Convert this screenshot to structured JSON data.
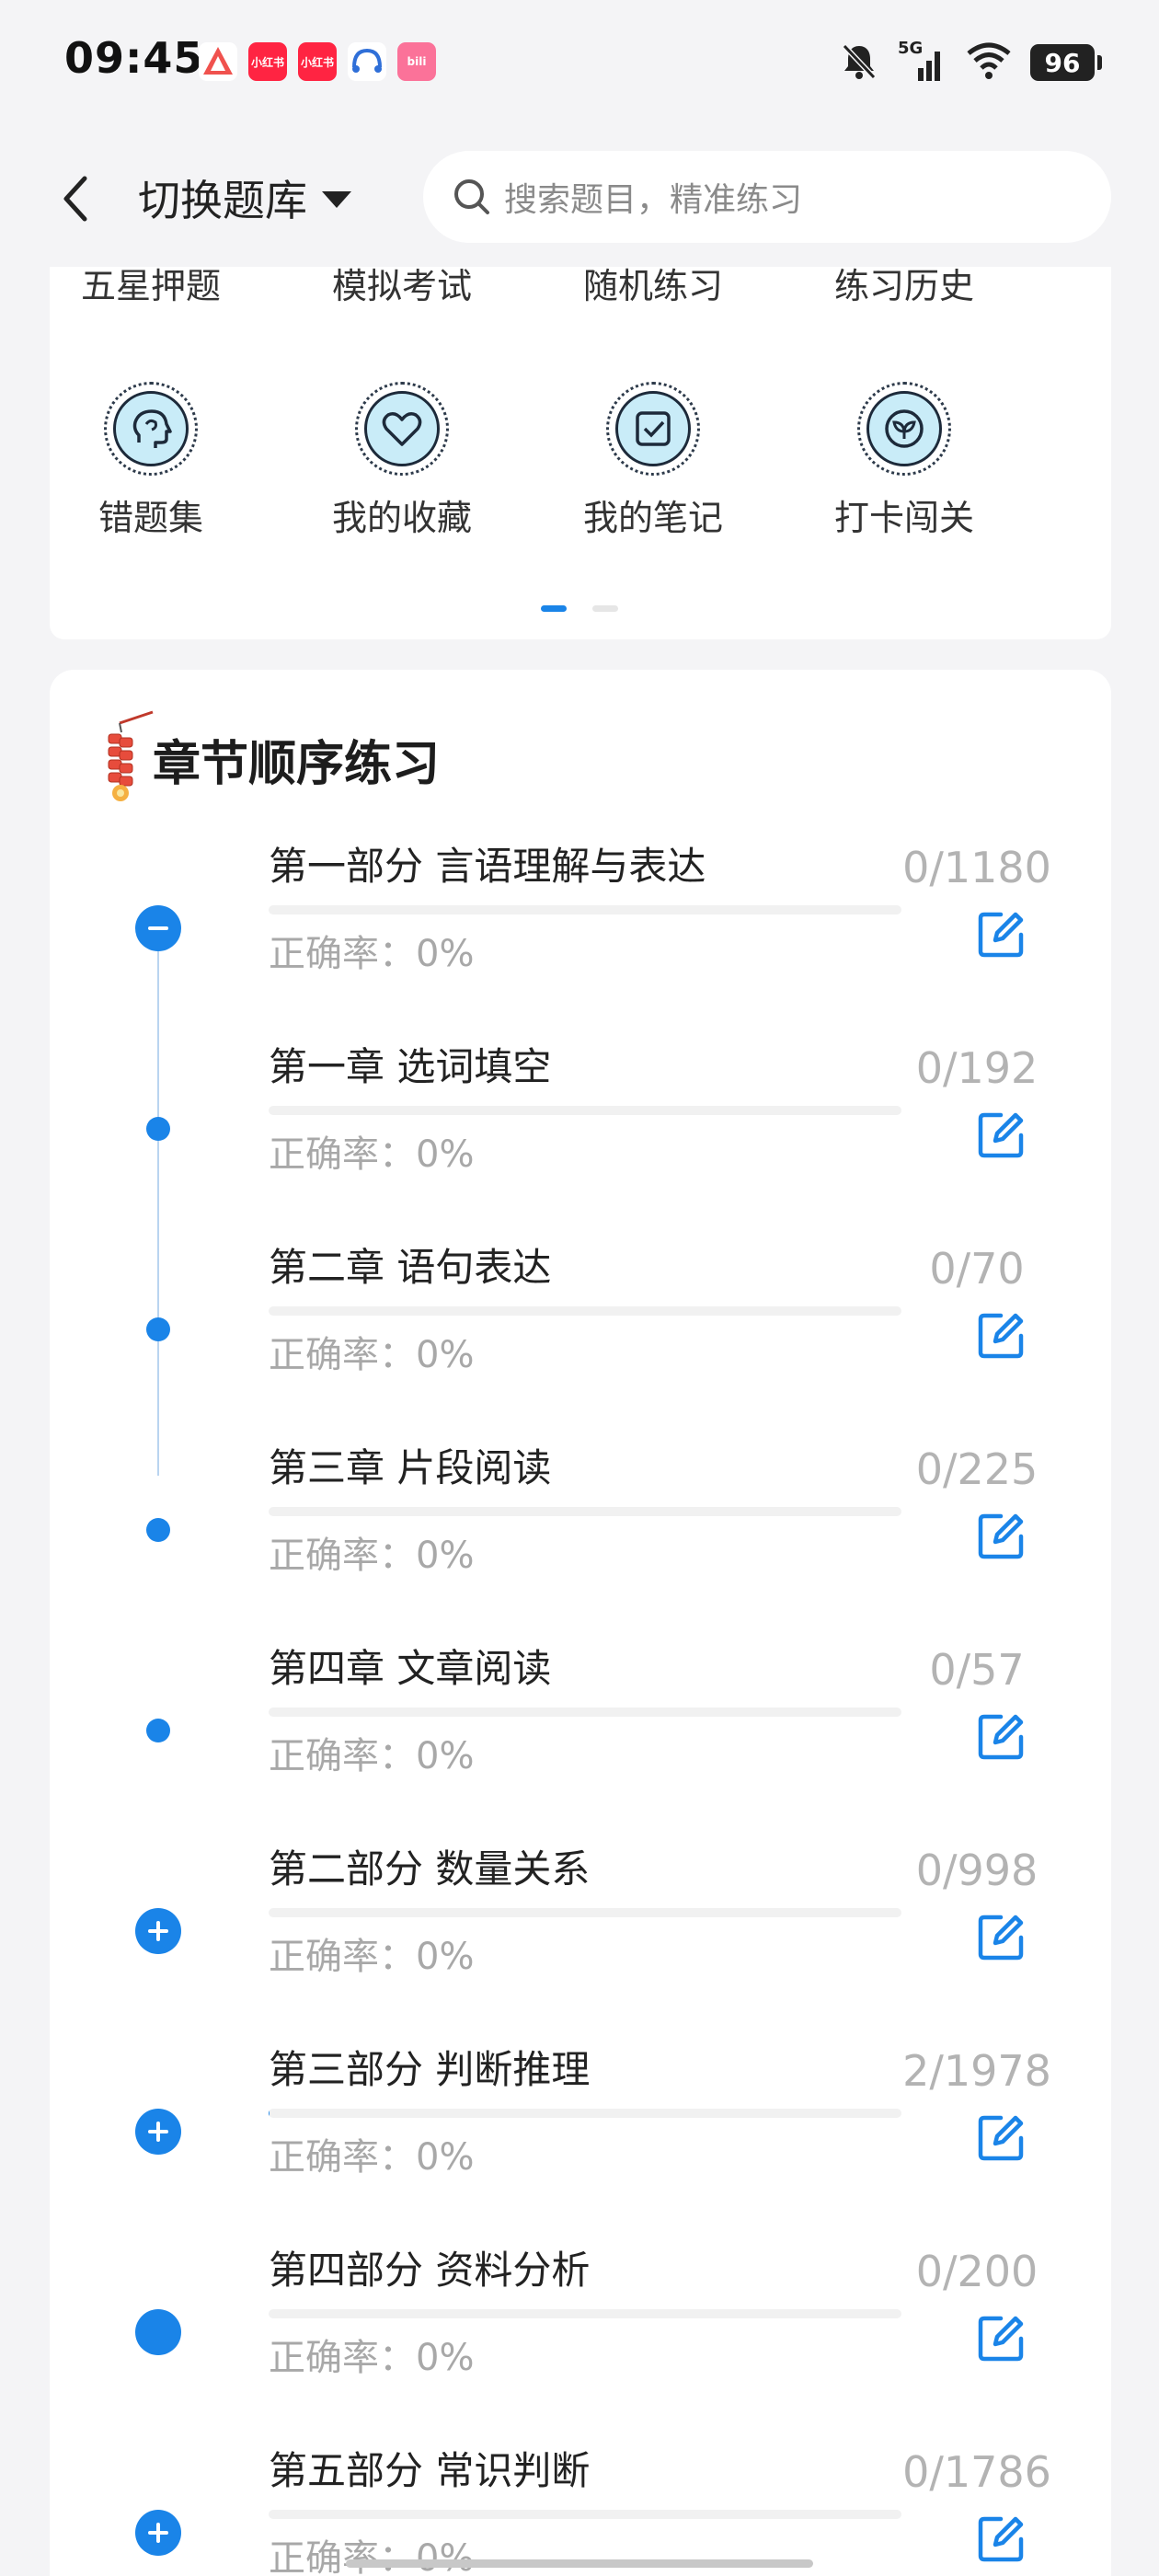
{
  "status_bar": {
    "time": "09:45",
    "network": "5G",
    "battery": "96",
    "icons": [
      "notifications-off-icon",
      "signal-5g-icon",
      "wifi-icon",
      "battery-icon"
    ]
  },
  "header": {
    "switch_bank_label": "切换题库",
    "search_placeholder": "搜索题目，精准练习"
  },
  "features": {
    "top_row": [
      {
        "label": "五星押题"
      },
      {
        "label": "模拟考试"
      },
      {
        "label": "随机练习"
      },
      {
        "label": "练习历史"
      }
    ],
    "bottom_row": [
      {
        "label": "错题集",
        "icon": "head-icon"
      },
      {
        "label": "我的收藏",
        "icon": "heart-icon"
      },
      {
        "label": "我的笔记",
        "icon": "note-check-icon"
      },
      {
        "label": "打卡闯关",
        "icon": "sprout-icon"
      }
    ],
    "page_indicator": {
      "current": 1,
      "total": 2
    }
  },
  "chapters": {
    "title": "章节顺序练习",
    "accent_color": "#1a84e8",
    "items": [
      {
        "title": "第一部分 言语理解与表达",
        "count": "0/1180",
        "accuracy": "正确率：0%",
        "progress": 0,
        "node": "minus"
      },
      {
        "title": "第一章 选词填空",
        "count": "0/192",
        "accuracy": "正确率：0%",
        "progress": 0,
        "node": "small"
      },
      {
        "title": "第二章 语句表达",
        "count": "0/70",
        "accuracy": "正确率：0%",
        "progress": 0,
        "node": "small"
      },
      {
        "title": "第三章 片段阅读",
        "count": "0/225",
        "accuracy": "正确率：0%",
        "progress": 0,
        "node": "small"
      },
      {
        "title": "第四章 文章阅读",
        "count": "0/57",
        "accuracy": "正确率：0%",
        "progress": 0,
        "node": "small"
      },
      {
        "title": "第二部分 数量关系",
        "count": "0/998",
        "accuracy": "正确率：0%",
        "progress": 0,
        "node": "plus"
      },
      {
        "title": "第三部分 判断推理",
        "count": "2/1978",
        "accuracy": "正确率：0%",
        "progress": 0.001,
        "node": "plus"
      },
      {
        "title": "第四部分 资料分析",
        "count": "0/200",
        "accuracy": "正确率：0%",
        "progress": 0,
        "node": "full"
      },
      {
        "title": "第五部分 常识判断",
        "count": "0/1786",
        "accuracy": "正确率：0%",
        "progress": 0,
        "node": "plus"
      }
    ]
  }
}
